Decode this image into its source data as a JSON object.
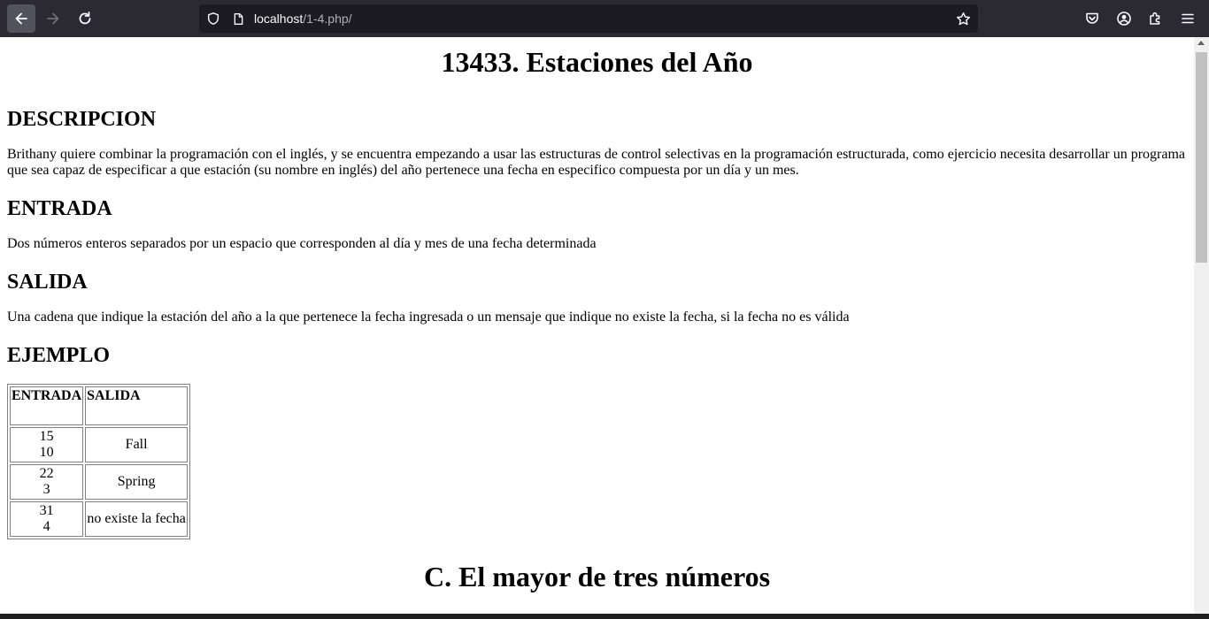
{
  "browser": {
    "url_host": "localhost",
    "url_path": "/1-4.php/",
    "colors": {
      "chrome": "#2b2a33",
      "urlbar": "#1c1b22"
    }
  },
  "page": {
    "title": "13433. Estaciones del Año",
    "descripcion_heading": "DESCRIPCION",
    "descripcion_text": "Brithany quiere combinar la programación con el inglés, y se encuentra empezando a usar las estructuras de control selectivas en la programación estructurada, como ejercicio necesita desarrollar un programa que sea capaz de especificar a que estación (su nombre en inglés) del año pertenece una fecha en especifico compuesta por un día y un mes.",
    "entrada_heading": "ENTRADA",
    "entrada_text": "Dos números enteros separados por un espacio que corresponden al día y mes de una fecha determinada",
    "salida_heading": "SALIDA",
    "salida_text": "Una cadena que indique la estación del año a la que pertenece la fecha ingresada o un mensaje que indique no existe la fecha, si la fecha no es válida",
    "ejemplo_heading": "EJEMPLO",
    "table": {
      "headers": [
        "ENTRADA",
        "SALIDA"
      ],
      "rows": [
        {
          "day": "15",
          "month": "10",
          "output": "Fall"
        },
        {
          "day": "22",
          "month": "3",
          "output": "Spring"
        },
        {
          "day": "31",
          "month": "4",
          "output": "no existe la fecha"
        }
      ]
    },
    "next_title": "C. El mayor de tres números"
  }
}
